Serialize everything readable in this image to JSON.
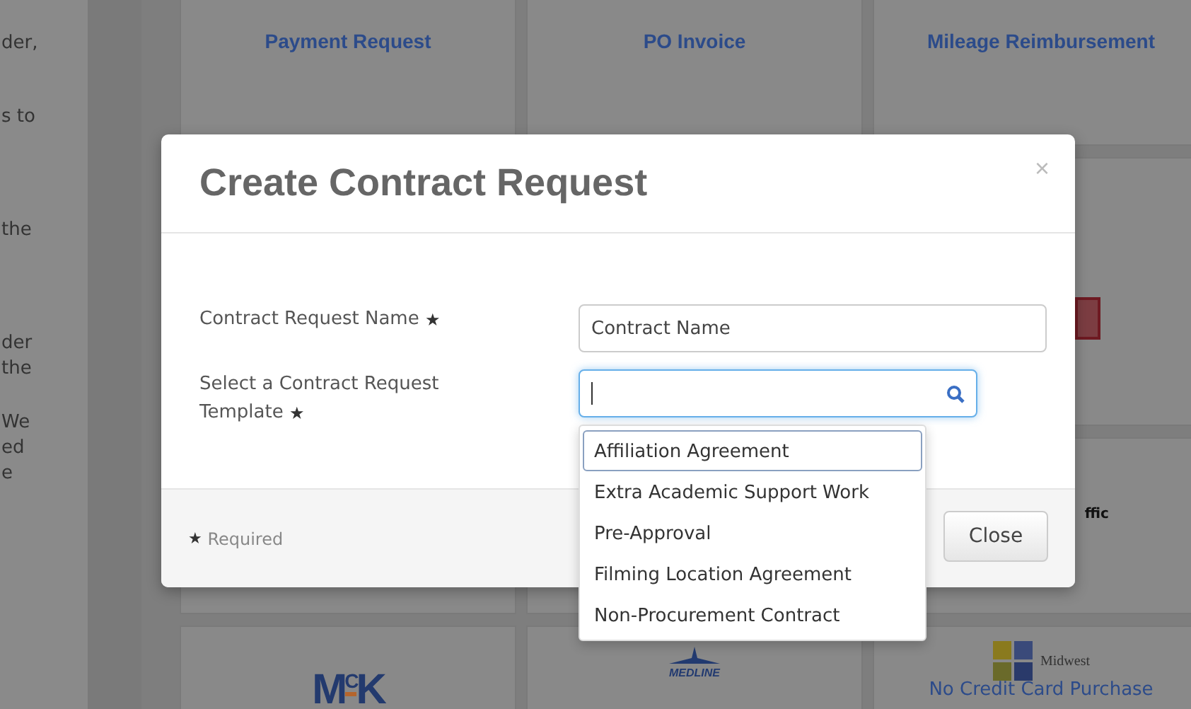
{
  "background": {
    "side_paragraphs": [
      [
        "der,"
      ],
      [
        "s to"
      ],
      [
        "the"
      ],
      [
        "der",
        "the"
      ],
      [
        "We",
        "ed",
        "e"
      ]
    ],
    "tile_rows": [
      [
        {
          "kind": "title",
          "text": "Payment Request"
        },
        {
          "kind": "title",
          "text": "PO Invoice"
        },
        {
          "kind": "title",
          "text": "Mileage Reimbursement"
        }
      ],
      [
        {
          "kind": "blank"
        },
        {
          "kind": "blank"
        },
        {
          "kind": "red-logo"
        }
      ],
      [
        {
          "kind": "blank"
        },
        {
          "kind": "blank"
        },
        {
          "kind": "fragment",
          "text": "ffic"
        }
      ],
      [
        {
          "kind": "mck",
          "text": "M$^{C}$K"
        },
        {
          "kind": "medline",
          "text": "MEDLINE"
        },
        {
          "kind": "midwest",
          "text": "Midwest",
          "caption": "No Credit Card Purchase"
        }
      ]
    ]
  },
  "modal": {
    "title": "Create Contract Request",
    "close": "×",
    "required_mark": "★",
    "fields": [
      {
        "kind": "text",
        "label": "Contract Request Name",
        "required": true,
        "value": "Contract Name",
        "focused": false
      },
      {
        "kind": "search",
        "label": "Select a Contract Request Template",
        "required": true,
        "focused": true
      }
    ],
    "options": [
      {
        "label": "Affiliation Agreement",
        "selected": true
      },
      {
        "label": "Extra Academic Support Work",
        "selected": false
      },
      {
        "label": "Pre-Approval",
        "selected": false
      },
      {
        "label": "Filming Location Agreement",
        "selected": false
      },
      {
        "label": "Non-Procurement Contract",
        "selected": false
      }
    ],
    "footer_note": "Required",
    "button": "Close"
  }
}
